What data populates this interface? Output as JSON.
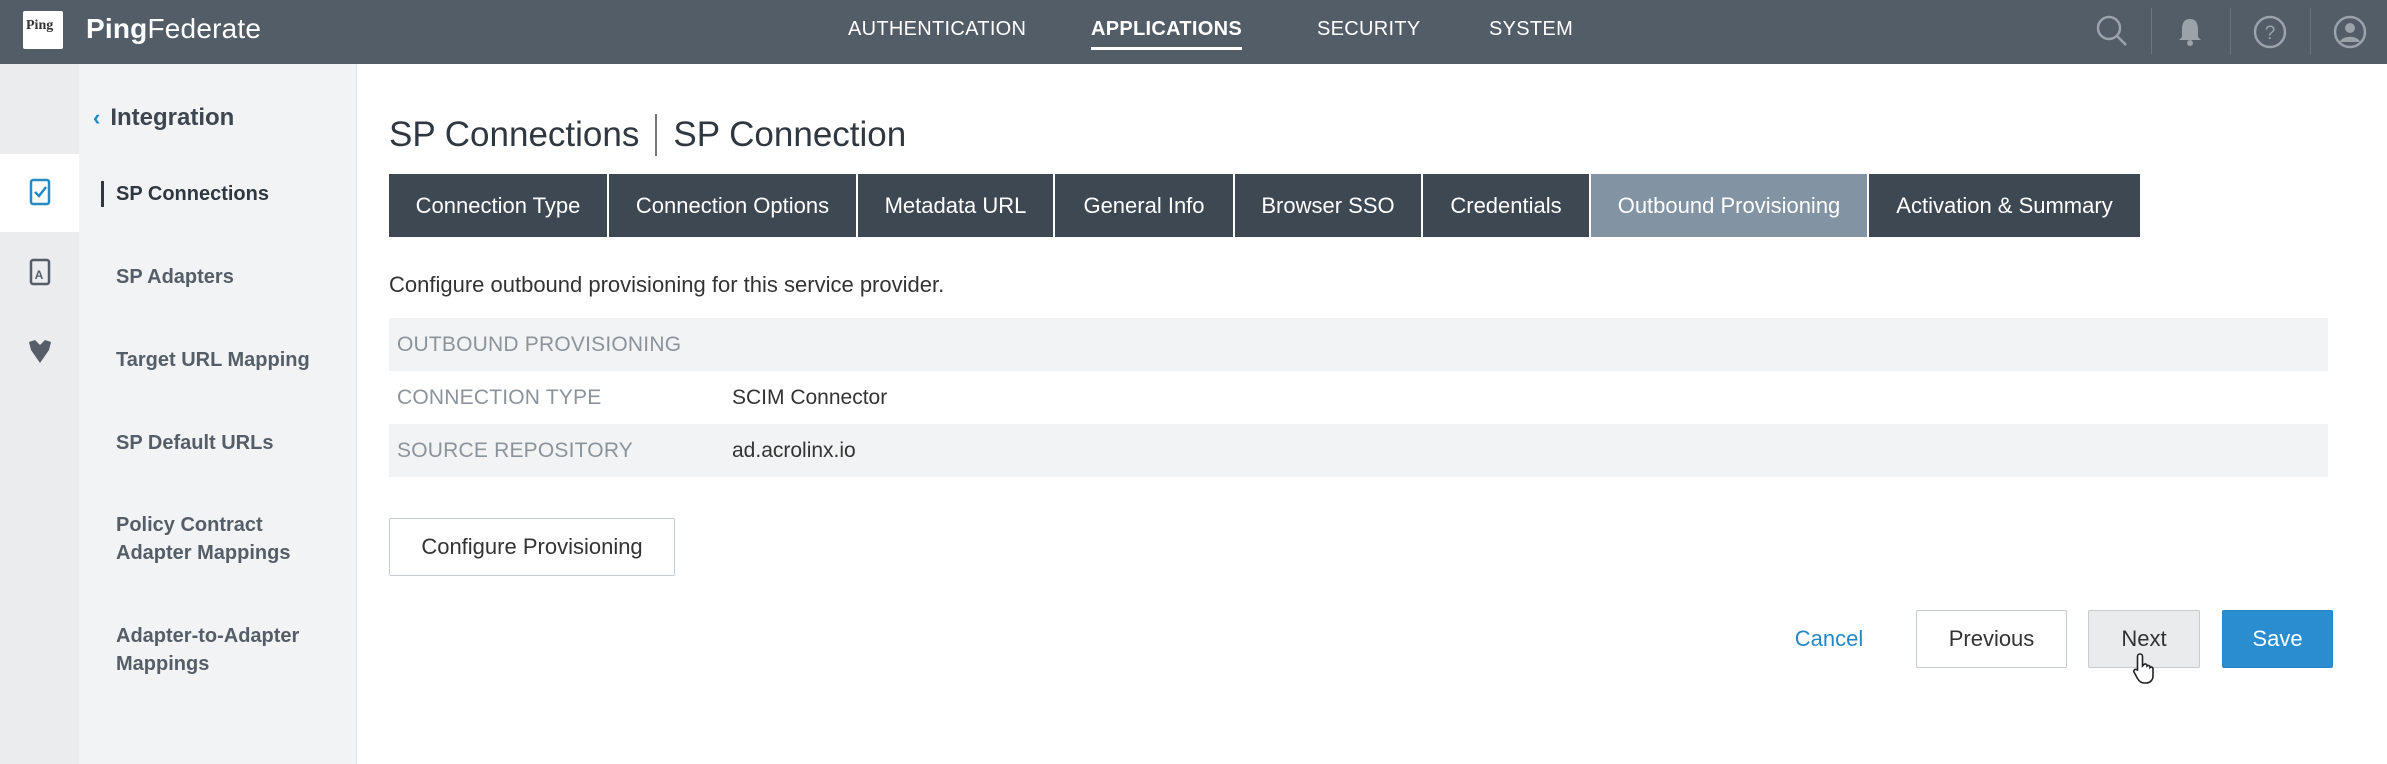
{
  "header": {
    "logo_text": "Ping",
    "brand_bold": "Ping",
    "brand_light": "Federate",
    "nav": [
      {
        "label": "AUTHENTICATION",
        "active": false
      },
      {
        "label": "APPLICATIONS",
        "active": true
      },
      {
        "label": "SECURITY",
        "active": false
      },
      {
        "label": "SYSTEM",
        "active": false
      }
    ],
    "icons": [
      "search-icon",
      "bell-icon",
      "help-icon",
      "user-icon"
    ]
  },
  "rail": {
    "icons": [
      "sp-connections-icon",
      "sp-adapters-icon",
      "target-mapping-icon"
    ]
  },
  "subnav": {
    "back_label": "Integration",
    "items": [
      {
        "label": "SP Connections",
        "active": true
      },
      {
        "label": "SP Adapters",
        "active": false
      },
      {
        "label": "Target URL Mapping",
        "active": false
      },
      {
        "label": "SP Default URLs",
        "active": false
      },
      {
        "label": "Policy Contract Adapter Mappings",
        "line1": "Policy Contract",
        "line2": "Adapter Mappings",
        "active": false
      },
      {
        "label": "Adapter-to-Adapter Mappings",
        "line1": "Adapter-to-Adapter",
        "line2": "Mappings",
        "active": false
      }
    ]
  },
  "main": {
    "breadcrumb_parent": "SP Connections",
    "breadcrumb_current": "SP Connection",
    "tabs": [
      {
        "label": "Connection Type",
        "active": false
      },
      {
        "label": "Connection Options",
        "active": false
      },
      {
        "label": "Metadata URL",
        "active": false
      },
      {
        "label": "General Info",
        "active": false
      },
      {
        "label": "Browser SSO",
        "active": false
      },
      {
        "label": "Credentials",
        "active": false
      },
      {
        "label": "Outbound Provisioning",
        "active": true
      },
      {
        "label": "Activation & Summary",
        "active": false
      }
    ],
    "description": "Configure outbound provisioning for this service provider.",
    "summary": {
      "section_label": "OUTBOUND PROVISIONING",
      "rows": [
        {
          "label": "CONNECTION TYPE",
          "value": "SCIM Connector"
        },
        {
          "label": "SOURCE REPOSITORY",
          "value": "ad.acrolinx.io"
        }
      ]
    },
    "configure_button": "Configure Provisioning",
    "actions": {
      "cancel": "Cancel",
      "previous": "Previous",
      "next": "Next",
      "save": "Save"
    }
  },
  "colors": {
    "topbar": "#535d68",
    "tab_default": "#3e4853",
    "tab_active": "#8293a4",
    "primary": "#2a8dd0",
    "link": "#2589c5"
  }
}
